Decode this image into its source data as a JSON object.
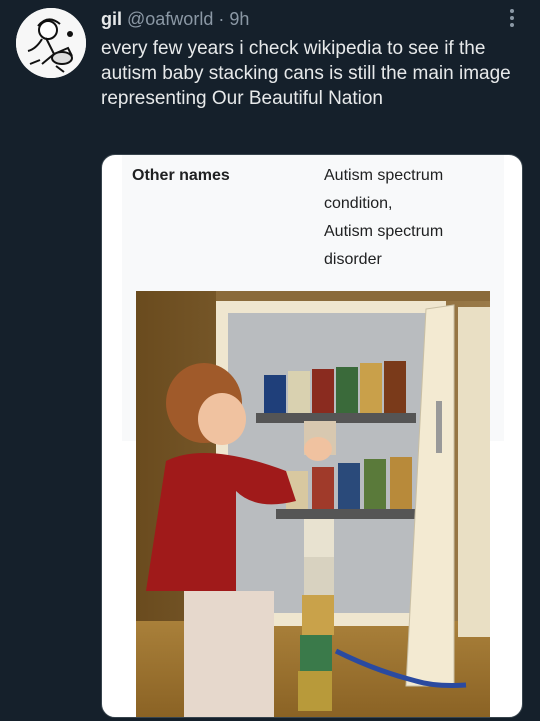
{
  "tweet": {
    "display_name": "gil",
    "handle": "@oafworld",
    "separator": "·",
    "time": "9h",
    "text": "every few years i check wikipedia to see if the autism baby stacking cans is still the main image representing Our Beautiful Nation",
    "more_icon": "more-vertical-icon"
  },
  "infobox": {
    "label": "Other names",
    "value_line1": "Autism spectrum",
    "value_line2": "condition,",
    "value_line3": "Autism spectrum",
    "value_line4": "disorder"
  },
  "colors": {
    "background": "#15202b",
    "text": "#e7e9ea",
    "muted": "#8b98a5",
    "card": "#ffffff"
  }
}
